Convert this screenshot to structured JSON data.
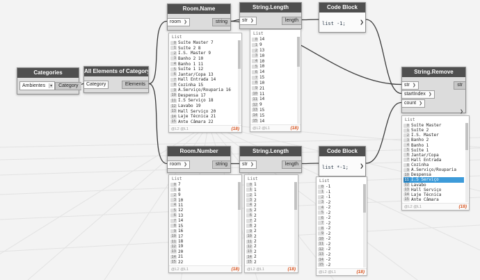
{
  "colors": {
    "canvas-bg": "#f3f3f3",
    "grid-line": "#e2e2e2",
    "node-header": "#4f4f4f",
    "node-body": "#dcdcdc",
    "port-out": "#c7c7c7",
    "wire": "#3a3a3a",
    "count": "#d9531e",
    "highlight": "#3d9bd9"
  },
  "icons": {
    "chevron_right": "❯",
    "chevron_down": "▾"
  },
  "nodes": {
    "categories": {
      "title": "Categories",
      "dropdown": "Ambientes",
      "outputs": [
        "Category"
      ]
    },
    "all_elements": {
      "title": "All Elements of Category",
      "inputs": [
        "Category"
      ],
      "outputs": [
        "Elements"
      ]
    },
    "room_name": {
      "title": "Room.Name",
      "inputs": [
        "room"
      ],
      "outputs": [
        "string"
      ]
    },
    "string_length_top": {
      "title": "String.Length",
      "inputs": [
        "str"
      ],
      "outputs": [
        "length"
      ]
    },
    "code_block_top": {
      "title": "Code Block",
      "code": "list -1;"
    },
    "room_number": {
      "title": "Room.Number",
      "inputs": [
        "room"
      ],
      "outputs": [
        "string"
      ]
    },
    "string_length_bottom": {
      "title": "String.Length",
      "inputs": [
        "str"
      ],
      "outputs": [
        "length"
      ]
    },
    "code_block_bottom": {
      "title": "Code Block",
      "code": "list *-1;"
    },
    "string_remove": {
      "title": "String.Remove",
      "inputs": [
        "str",
        "startIndex",
        "count"
      ],
      "outputs": [
        "str"
      ]
    }
  },
  "previews": {
    "room_name": {
      "label": "List",
      "items": [
        "Suíte Master 7",
        "Suíte 2 8",
        "I.S. Master 9",
        "Banho 2 10",
        "Banho 1 11",
        "Suíte 1 12",
        "Jantar/Copa 13",
        "Hall Entrada 14",
        "Cozinha 15",
        "A.Serviço/Rouparia 16",
        "Despensa 17",
        "I.S Serviço 18",
        "Lavabo 19",
        "Hall Serviço 20",
        "Laje Técnica 21",
        "Ante Câmara 22"
      ],
      "levels": "@L2 @L1",
      "count": "(18)"
    },
    "length_top": {
      "label": "List",
      "items": [
        "14",
        "9",
        "13",
        "10",
        "10",
        "10",
        "14",
        "15",
        "10",
        "21",
        "11",
        "14",
        "9",
        "15",
        "15",
        "14"
      ],
      "levels": "@L2 @L1",
      "count": "(18)"
    },
    "room_number": {
      "label": "List",
      "items": [
        "7",
        "8",
        "9",
        "10",
        "11",
        "12",
        "13",
        "14",
        "15",
        "16",
        "17",
        "18",
        "19",
        "20",
        "21",
        "22"
      ],
      "levels": "@L2 @L1",
      "count": "(18)"
    },
    "length_bottom": {
      "label": "List",
      "items": [
        "1",
        "1",
        "1",
        "2",
        "2",
        "2",
        "2",
        "2",
        "2",
        "2",
        "2",
        "2",
        "2",
        "2",
        "2",
        "2"
      ],
      "levels": "@L2 @L1",
      "count": "(18)"
    },
    "code_block": {
      "label": "List",
      "items": [
        "-1",
        "-1",
        "-1",
        "-2",
        "-2",
        "-2",
        "-2",
        "-2",
        "-2",
        "-2",
        "-2",
        "-2",
        "-2",
        "-2",
        "-2",
        "-2"
      ],
      "levels": "@L2 @L1",
      "count": "(18)"
    },
    "string_remove": {
      "label": "List",
      "items": [
        "Suíte Master",
        "Suíte 2",
        "I.S. Master",
        "Banho 2",
        "Banho 1",
        "Suíte 1",
        "Jantar/Copa",
        "Hall Entrada",
        "Cozinha",
        "A.Serviço/Rouparia",
        "Despensa",
        "I.S Serviço",
        "Lavabo",
        "Hall Serviço",
        "Laje Técnica",
        "Ante Câmara"
      ],
      "highlight": 11,
      "levels": "@L2 @L1",
      "count": "(18)"
    }
  }
}
